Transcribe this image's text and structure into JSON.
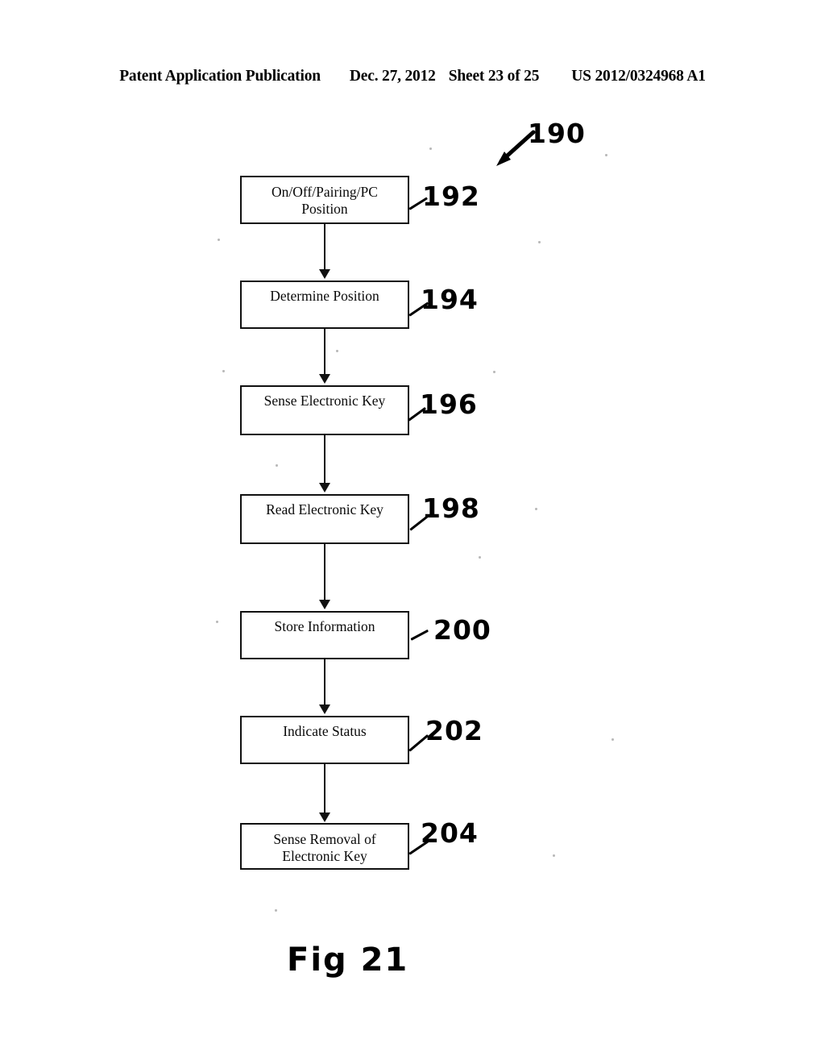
{
  "header": {
    "publication": "Patent Application Publication",
    "date": "Dec. 27, 2012",
    "sheet": "Sheet 23 of 25",
    "pub_number": "US 2012/0324968 A1"
  },
  "figure": {
    "caption": "Fig 21",
    "diagram_ref": "190",
    "nodes": [
      {
        "id": "node-1",
        "ref": "192",
        "line1": "On/Off/Pairing/PC",
        "line2": "Position"
      },
      {
        "id": "node-2",
        "ref": "194",
        "line1": "Determine Position",
        "line2": ""
      },
      {
        "id": "node-3",
        "ref": "196",
        "line1": "Sense Electronic Key",
        "line2": ""
      },
      {
        "id": "node-4",
        "ref": "198",
        "line1": "Read Electronic Key",
        "line2": ""
      },
      {
        "id": "node-5",
        "ref": "200",
        "line1": "Store Information",
        "line2": ""
      },
      {
        "id": "node-6",
        "ref": "202",
        "line1": "Indicate Status",
        "line2": ""
      },
      {
        "id": "node-7",
        "ref": "204",
        "line1": "Sense Removal of",
        "line2": "Electronic Key"
      }
    ]
  }
}
